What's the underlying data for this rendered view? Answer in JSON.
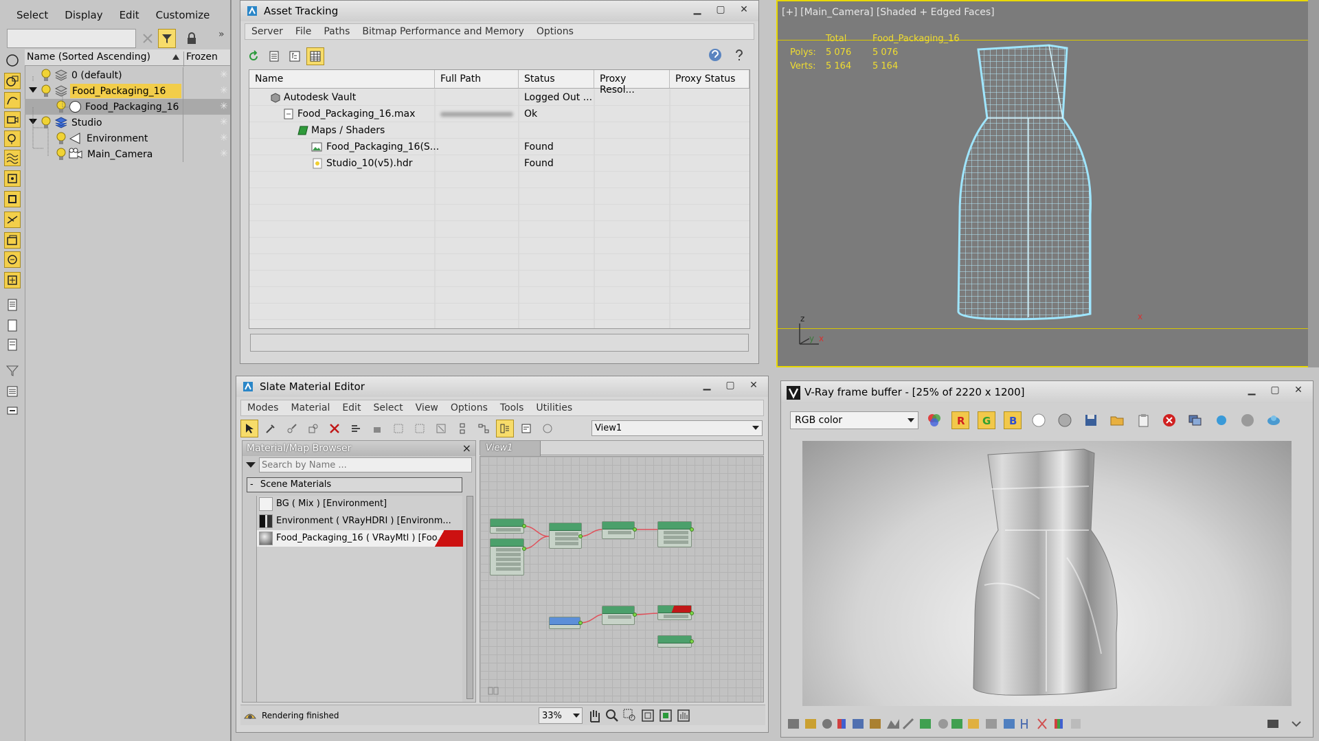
{
  "left_panel": {
    "menu": [
      "Select",
      "Display",
      "Edit",
      "Customize"
    ],
    "header": {
      "name_col": "Name (Sorted Ascending)",
      "frozen_col": "Frozen"
    },
    "rows": [
      {
        "label": "0 (default)"
      },
      {
        "label": "Food_Packaging_16"
      },
      {
        "label": "Food_Packaging_16"
      },
      {
        "label": "Studio"
      },
      {
        "label": "Environment"
      },
      {
        "label": "Main_Camera"
      }
    ]
  },
  "asset_tracking": {
    "title": "Asset Tracking",
    "menu": [
      "Server",
      "File",
      "Paths",
      "Bitmap Performance and Memory",
      "Options"
    ],
    "columns": [
      "Name",
      "Full Path",
      "Status",
      "Proxy Resol...",
      "Proxy Status"
    ],
    "rows": [
      {
        "name": "Autodesk Vault",
        "status": "Logged Out ..."
      },
      {
        "name": "Food_Packaging_16.max",
        "status": "Ok"
      },
      {
        "name": "Maps / Shaders",
        "status": ""
      },
      {
        "name": "Food_Packaging_16(S...",
        "status": "Found"
      },
      {
        "name": "Studio_10(v5).hdr",
        "status": "Found"
      }
    ]
  },
  "viewport": {
    "label": "[+] [Main_Camera] [Shaded + Edged Faces]",
    "stats_header": {
      "total": "Total",
      "object": "Food_Packaging_16"
    },
    "polys": {
      "label": "Polys:",
      "total": "5 076",
      "object": "5 076"
    },
    "verts": {
      "label": "Verts:",
      "total": "5 164",
      "object": "5 164"
    },
    "axes": {
      "x": "x",
      "y": "y",
      "z": "z"
    }
  },
  "slate_editor": {
    "title": "Slate Material Editor",
    "menu": [
      "Modes",
      "Material",
      "Edit",
      "Select",
      "View",
      "Options",
      "Tools",
      "Utilities"
    ],
    "view_select": "View1",
    "browser_title": "Material/Map Browser",
    "browser_close": "×",
    "search_placeholder": "Search by Name ...",
    "section": "Scene Materials",
    "section_toggle": "-",
    "materials": [
      "BG ( Mix ) [Environment]",
      "Environment ( VRayHDRI ) [Environm...",
      "Food_Packaging_16 ( VRayMtl ) [Foo..."
    ],
    "view_tab": "View1",
    "status": "Rendering finished",
    "zoom": "33%"
  },
  "vray": {
    "title": "V-Ray frame buffer - [25% of 2220 x 1200]",
    "channel": "RGB color"
  },
  "colors": {
    "viewport_bg": "#7b7b7b",
    "viewport_border": "#e9d900",
    "wire": "#9fe6ff",
    "highlight": "#f2cd4a",
    "node_green": "#4ba06b",
    "link_red": "#e0505a"
  }
}
